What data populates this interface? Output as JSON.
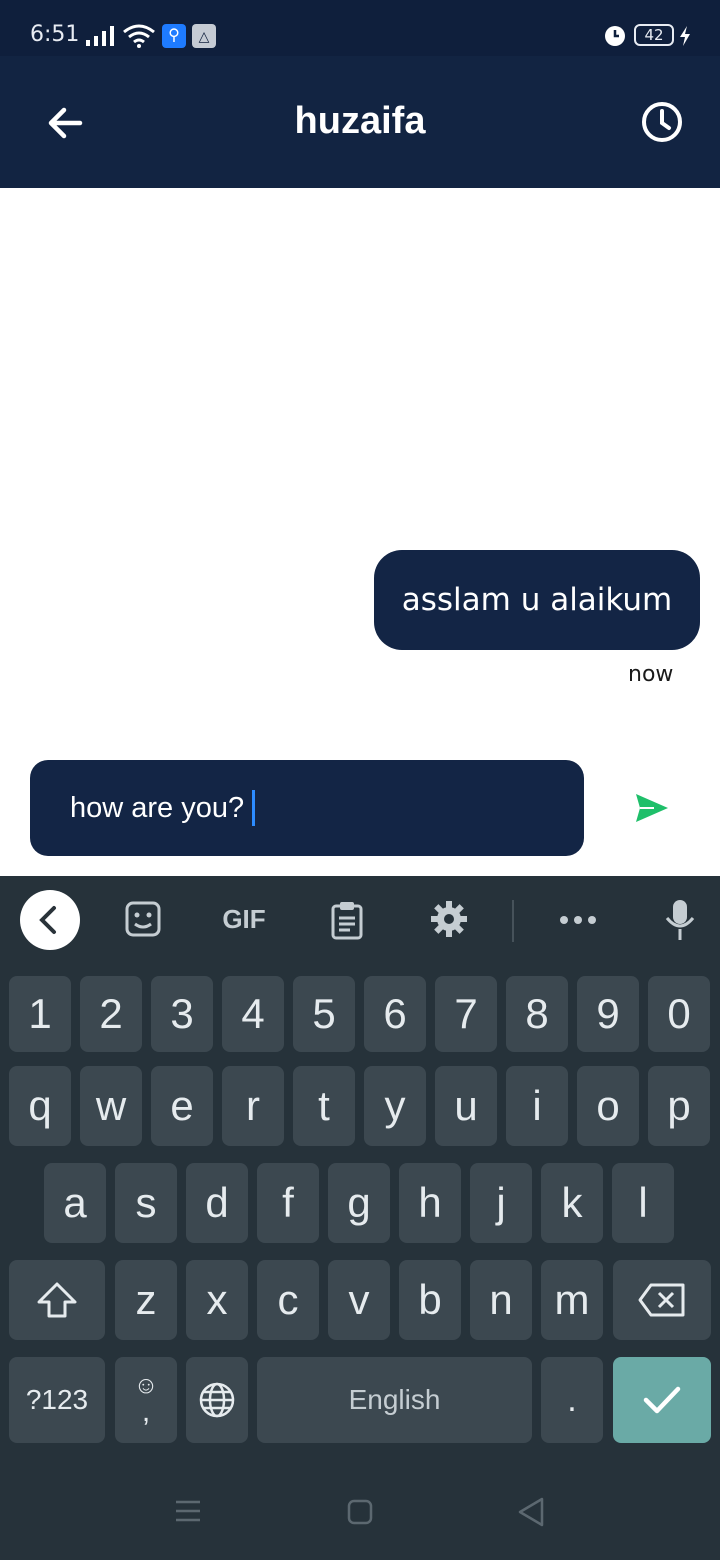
{
  "status_bar": {
    "time": "6:51",
    "battery": "42",
    "icons": [
      "signal-icon",
      "wifi-icon",
      "usb-icon",
      "drive-icon",
      "alarm-icon",
      "battery-icon",
      "charging-icon"
    ]
  },
  "header": {
    "title": "huzaifa",
    "back_icon": "arrow-left-icon",
    "history_icon": "clock-icon",
    "bg_color": "#122442"
  },
  "conversation": {
    "messages": [
      {
        "text": "asslam u alaikum",
        "time": "now",
        "sender": "me"
      }
    ]
  },
  "composer": {
    "value": "how are you?",
    "send_icon": "send-icon",
    "send_color": "#1fbf6a"
  },
  "keyboard": {
    "toolbar": [
      "collapse-icon",
      "sticker-icon",
      "gif-icon",
      "clipboard-icon",
      "settings-icon",
      "more-icon",
      "mic-icon"
    ],
    "gif_label": "GIF",
    "row_numbers": [
      "1",
      "2",
      "3",
      "4",
      "5",
      "6",
      "7",
      "8",
      "9",
      "0"
    ],
    "row1": [
      "q",
      "w",
      "e",
      "r",
      "t",
      "y",
      "u",
      "i",
      "o",
      "p"
    ],
    "row2": [
      "a",
      "s",
      "d",
      "f",
      "g",
      "h",
      "j",
      "k",
      "l"
    ],
    "row3": [
      "z",
      "x",
      "c",
      "v",
      "b",
      "n",
      "m"
    ],
    "symbols_label": "?123",
    "comma_label": ",",
    "space_label": "English",
    "period_label": ".",
    "accent_color": "#6aaaa6"
  },
  "nav_bar": {
    "icons": [
      "menu-icon",
      "home-icon",
      "back-icon"
    ]
  }
}
